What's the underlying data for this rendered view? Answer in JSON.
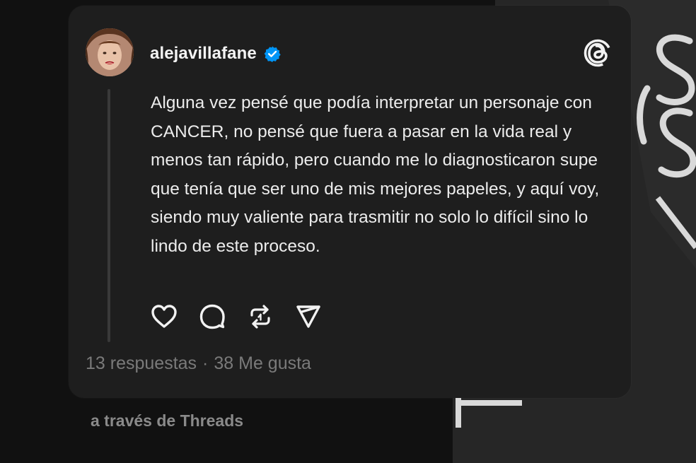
{
  "post": {
    "username": "alejavillafane",
    "verified": true,
    "text": "Alguna vez pensé que podía interpretar un personaje con CANCER, no pensé que fuera a pasar en la vida real y menos tan rápido, pero cuando me lo diagnosticaron supe que tenía que ser uno de mis mejores papeles, y aquí voy, siendo muy valiente para trasmitir no solo lo difícil sino lo lindo de este proceso.",
    "replies": "13 respuestas",
    "separator": "·",
    "likes": "38 Me gusta"
  },
  "footer": {
    "via": "a través de Threads"
  },
  "icons": {
    "verified": "verified-badge-icon",
    "logo": "threads-logo-icon",
    "like": "heart-icon",
    "reply": "comment-icon",
    "repost": "repost-icon",
    "share": "send-icon"
  },
  "colors": {
    "card": "#1e1e1e",
    "verified": "#0095f6",
    "text": "#ececec",
    "muted": "#7a7a7a"
  }
}
